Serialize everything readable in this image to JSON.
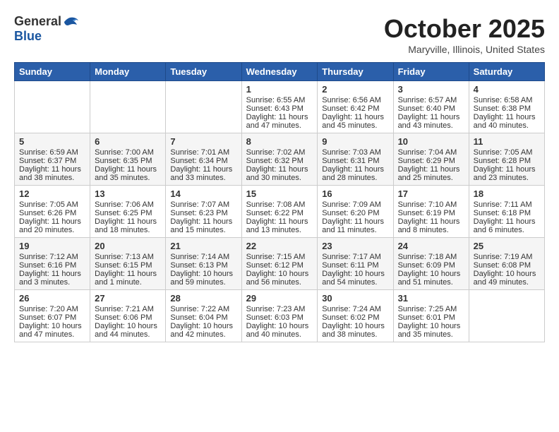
{
  "header": {
    "logo_general": "General",
    "logo_blue": "Blue",
    "month_title": "October 2025",
    "location": "Maryville, Illinois, United States"
  },
  "days_of_week": [
    "Sunday",
    "Monday",
    "Tuesday",
    "Wednesday",
    "Thursday",
    "Friday",
    "Saturday"
  ],
  "weeks": [
    [
      {
        "day": "",
        "content": ""
      },
      {
        "day": "",
        "content": ""
      },
      {
        "day": "",
        "content": ""
      },
      {
        "day": "1",
        "content": "Sunrise: 6:55 AM\nSunset: 6:43 PM\nDaylight: 11 hours\nand 47 minutes."
      },
      {
        "day": "2",
        "content": "Sunrise: 6:56 AM\nSunset: 6:42 PM\nDaylight: 11 hours\nand 45 minutes."
      },
      {
        "day": "3",
        "content": "Sunrise: 6:57 AM\nSunset: 6:40 PM\nDaylight: 11 hours\nand 43 minutes."
      },
      {
        "day": "4",
        "content": "Sunrise: 6:58 AM\nSunset: 6:38 PM\nDaylight: 11 hours\nand 40 minutes."
      }
    ],
    [
      {
        "day": "5",
        "content": "Sunrise: 6:59 AM\nSunset: 6:37 PM\nDaylight: 11 hours\nand 38 minutes."
      },
      {
        "day": "6",
        "content": "Sunrise: 7:00 AM\nSunset: 6:35 PM\nDaylight: 11 hours\nand 35 minutes."
      },
      {
        "day": "7",
        "content": "Sunrise: 7:01 AM\nSunset: 6:34 PM\nDaylight: 11 hours\nand 33 minutes."
      },
      {
        "day": "8",
        "content": "Sunrise: 7:02 AM\nSunset: 6:32 PM\nDaylight: 11 hours\nand 30 minutes."
      },
      {
        "day": "9",
        "content": "Sunrise: 7:03 AM\nSunset: 6:31 PM\nDaylight: 11 hours\nand 28 minutes."
      },
      {
        "day": "10",
        "content": "Sunrise: 7:04 AM\nSunset: 6:29 PM\nDaylight: 11 hours\nand 25 minutes."
      },
      {
        "day": "11",
        "content": "Sunrise: 7:05 AM\nSunset: 6:28 PM\nDaylight: 11 hours\nand 23 minutes."
      }
    ],
    [
      {
        "day": "12",
        "content": "Sunrise: 7:05 AM\nSunset: 6:26 PM\nDaylight: 11 hours\nand 20 minutes."
      },
      {
        "day": "13",
        "content": "Sunrise: 7:06 AM\nSunset: 6:25 PM\nDaylight: 11 hours\nand 18 minutes."
      },
      {
        "day": "14",
        "content": "Sunrise: 7:07 AM\nSunset: 6:23 PM\nDaylight: 11 hours\nand 15 minutes."
      },
      {
        "day": "15",
        "content": "Sunrise: 7:08 AM\nSunset: 6:22 PM\nDaylight: 11 hours\nand 13 minutes."
      },
      {
        "day": "16",
        "content": "Sunrise: 7:09 AM\nSunset: 6:20 PM\nDaylight: 11 hours\nand 11 minutes."
      },
      {
        "day": "17",
        "content": "Sunrise: 7:10 AM\nSunset: 6:19 PM\nDaylight: 11 hours\nand 8 minutes."
      },
      {
        "day": "18",
        "content": "Sunrise: 7:11 AM\nSunset: 6:18 PM\nDaylight: 11 hours\nand 6 minutes."
      }
    ],
    [
      {
        "day": "19",
        "content": "Sunrise: 7:12 AM\nSunset: 6:16 PM\nDaylight: 11 hours\nand 3 minutes."
      },
      {
        "day": "20",
        "content": "Sunrise: 7:13 AM\nSunset: 6:15 PM\nDaylight: 11 hours\nand 1 minute."
      },
      {
        "day": "21",
        "content": "Sunrise: 7:14 AM\nSunset: 6:13 PM\nDaylight: 10 hours\nand 59 minutes."
      },
      {
        "day": "22",
        "content": "Sunrise: 7:15 AM\nSunset: 6:12 PM\nDaylight: 10 hours\nand 56 minutes."
      },
      {
        "day": "23",
        "content": "Sunrise: 7:17 AM\nSunset: 6:11 PM\nDaylight: 10 hours\nand 54 minutes."
      },
      {
        "day": "24",
        "content": "Sunrise: 7:18 AM\nSunset: 6:09 PM\nDaylight: 10 hours\nand 51 minutes."
      },
      {
        "day": "25",
        "content": "Sunrise: 7:19 AM\nSunset: 6:08 PM\nDaylight: 10 hours\nand 49 minutes."
      }
    ],
    [
      {
        "day": "26",
        "content": "Sunrise: 7:20 AM\nSunset: 6:07 PM\nDaylight: 10 hours\nand 47 minutes."
      },
      {
        "day": "27",
        "content": "Sunrise: 7:21 AM\nSunset: 6:06 PM\nDaylight: 10 hours\nand 44 minutes."
      },
      {
        "day": "28",
        "content": "Sunrise: 7:22 AM\nSunset: 6:04 PM\nDaylight: 10 hours\nand 42 minutes."
      },
      {
        "day": "29",
        "content": "Sunrise: 7:23 AM\nSunset: 6:03 PM\nDaylight: 10 hours\nand 40 minutes."
      },
      {
        "day": "30",
        "content": "Sunrise: 7:24 AM\nSunset: 6:02 PM\nDaylight: 10 hours\nand 38 minutes."
      },
      {
        "day": "31",
        "content": "Sunrise: 7:25 AM\nSunset: 6:01 PM\nDaylight: 10 hours\nand 35 minutes."
      },
      {
        "day": "",
        "content": ""
      }
    ]
  ]
}
